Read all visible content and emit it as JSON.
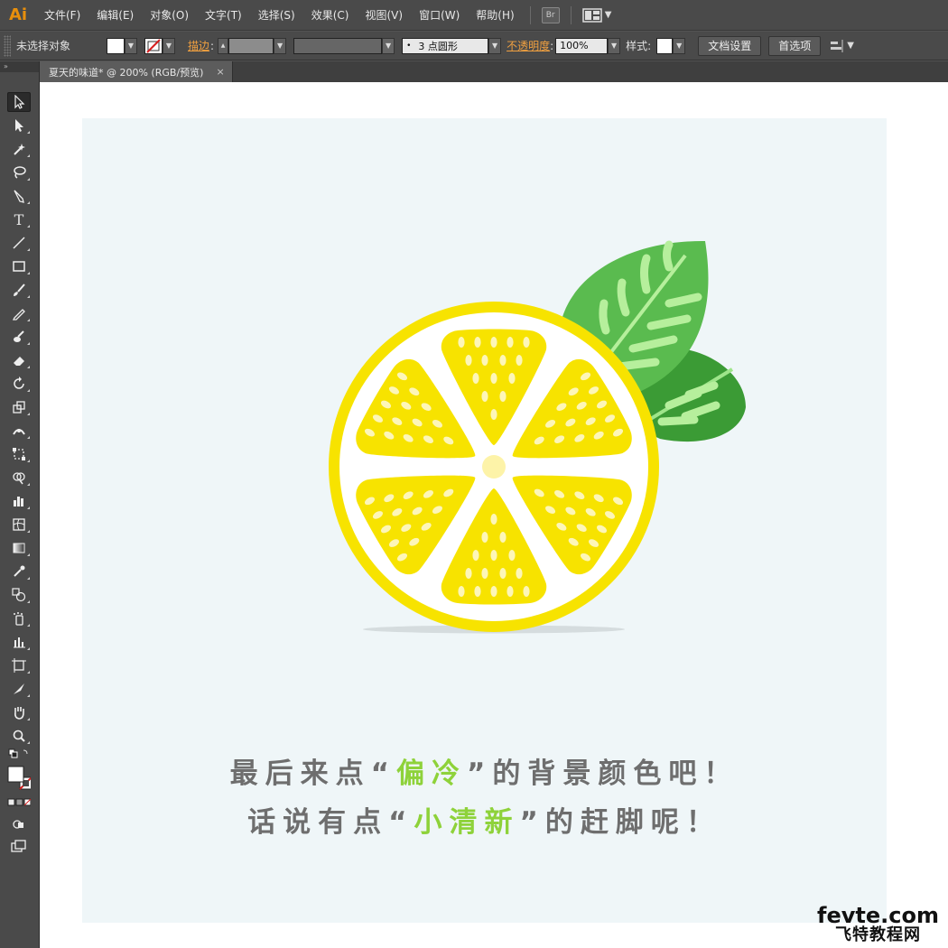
{
  "app": {
    "logo": "Ai",
    "menus": [
      "文件(F)",
      "编辑(E)",
      "对象(O)",
      "文字(T)",
      "选择(S)",
      "效果(C)",
      "视图(V)",
      "窗口(W)",
      "帮助(H)"
    ],
    "bridge_label": "Br"
  },
  "controlbar": {
    "selection": "未选择对象",
    "stroke_label": "描边",
    "brush": "3 点圆形",
    "opacity_label": "不透明度",
    "opacity_value": "100%",
    "style_label": "样式",
    "doc_setup": "文档设置",
    "preferences": "首选项"
  },
  "document": {
    "tab_title": "夏天的味道* @ 200% (RGB/预览)",
    "close": "×"
  },
  "artwork": {
    "caption_line1": {
      "before": "最后来点“",
      "highlight": "偏冷",
      "after": "”的背景颜色吧！"
    },
    "caption_line2": {
      "before": "话说有点“",
      "highlight": "小清新",
      "after": "”的赶脚呢！"
    },
    "colors": {
      "artboard_bg": "#eff6f8",
      "lemon_yellow": "#f7e300",
      "lemon_rind": "#f9ee3e",
      "seed": "#fdf6b8",
      "center": "#fdf3a8",
      "leaf_green": "#5abb4f",
      "leaf_dark": "#3b9b35",
      "vein_light": "#b6ef9c",
      "caption_gray": "#6e6e6e",
      "caption_highlight": "#8ed23a"
    }
  },
  "watermark": {
    "top": "fevte.com",
    "bottom": "飞特教程网"
  }
}
